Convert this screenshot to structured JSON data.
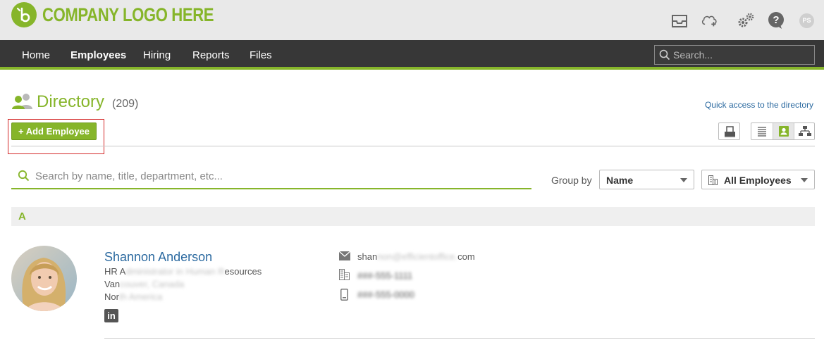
{
  "header": {
    "logo_text": "COMPANY LOGO HERE",
    "user_initials": "PS",
    "icons": [
      "inbox-icon",
      "cloud-upload-icon",
      "settings-gears-icon",
      "help-icon"
    ]
  },
  "nav": {
    "items": [
      {
        "label": "Home",
        "active": false
      },
      {
        "label": "Employees",
        "active": true
      },
      {
        "label": "Hiring",
        "active": false
      },
      {
        "label": "Reports",
        "active": false
      },
      {
        "label": "Files",
        "active": false
      }
    ],
    "search_placeholder": "Search..."
  },
  "directory": {
    "title": "Directory",
    "count": "(209)",
    "quick_link": "Quick access to the directory",
    "add_button": "Add Employee",
    "search_placeholder": "Search by name, title, department, etc...",
    "group_by_label": "Group by",
    "group_by_value": "Name",
    "filter_value": "All Employees"
  },
  "groups": [
    {
      "letter": "A",
      "employees": [
        {
          "name": "Shannon Anderson",
          "title_visible": "HR A",
          "title_blurred": "dministrator in Human R",
          "title_tail": "esources",
          "location_visible": "Van",
          "location_blurred": "couver, Canada",
          "region_visible": "Nor",
          "region_blurred": "th America",
          "email_visible_start": "shan",
          "email_blurred": "non@efficientoffice.",
          "email_visible_end": "com",
          "phone_work": "###-555-1111",
          "phone_mobile": "###-555-0000"
        }
      ]
    }
  ],
  "colors": {
    "accent": "#86b52a",
    "nav_bg": "#373737",
    "link": "#2c6aa0",
    "highlight": "#d42a2a"
  }
}
